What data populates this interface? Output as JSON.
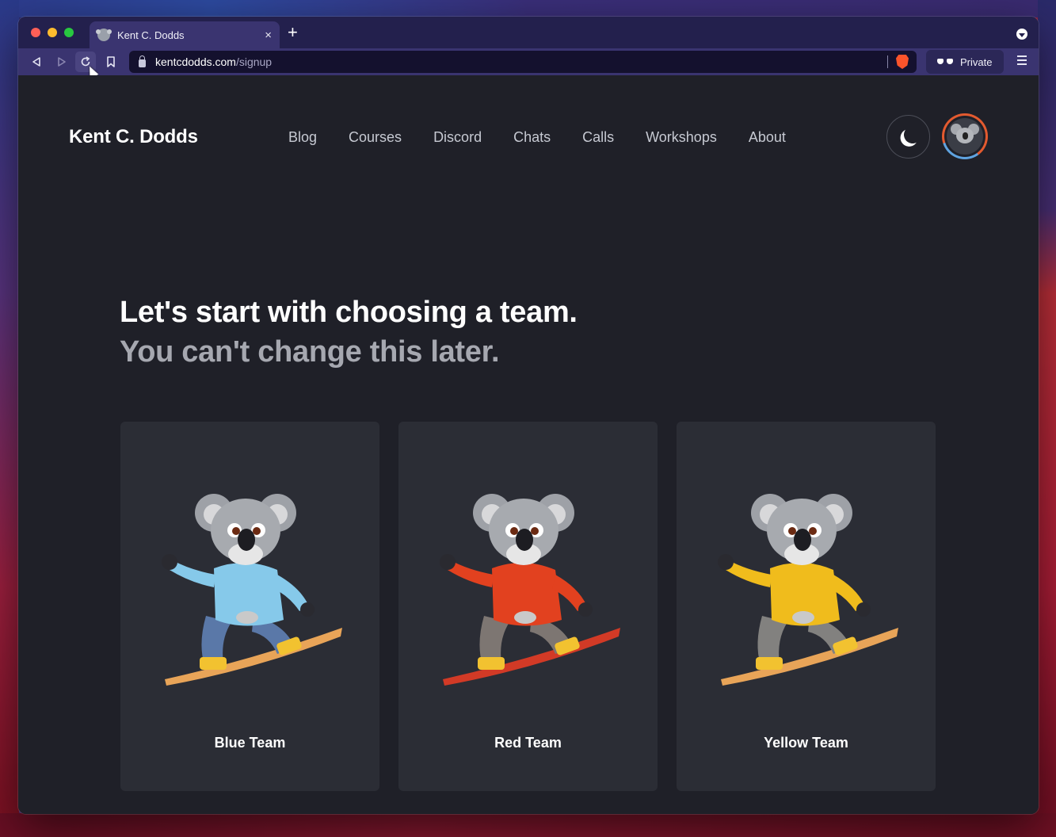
{
  "browser": {
    "tab_title": "Kent C. Dodds",
    "tab_close": "×",
    "new_tab": "+",
    "url_host": "kentcdodds.com",
    "url_path": "/signup",
    "private_label": "Private"
  },
  "site": {
    "logo": "Kent C. Dodds",
    "nav": [
      "Blog",
      "Courses",
      "Discord",
      "Chats",
      "Calls",
      "Workshops",
      "About"
    ]
  },
  "heading": {
    "line1": "Let's start with choosing a team.",
    "line2": "You can't change this later."
  },
  "teams": [
    {
      "label": "Blue Team",
      "shirt": "#86c9ea",
      "pants": "#5a78a8",
      "board": "#e8a458",
      "accent": "#f2c230"
    },
    {
      "label": "Red Team",
      "shirt": "#e2411f",
      "pants": "#7d7672",
      "board": "#d23a26",
      "accent": "#f2c230"
    },
    {
      "label": "Yellow Team",
      "shirt": "#f0bc1c",
      "pants": "#82817f",
      "board": "#e8a458",
      "accent": "#f2c230"
    }
  ],
  "icons": {
    "back": "back-icon",
    "forward": "forward-icon",
    "reload": "reload-icon",
    "bookmark": "bookmark-icon",
    "theme": "moon-icon",
    "menu": "hamburger-icon"
  },
  "colors": {
    "page_bg": "#1f2028",
    "card_bg": "#2b2d35",
    "text_secondary": "#a6a8b0"
  }
}
